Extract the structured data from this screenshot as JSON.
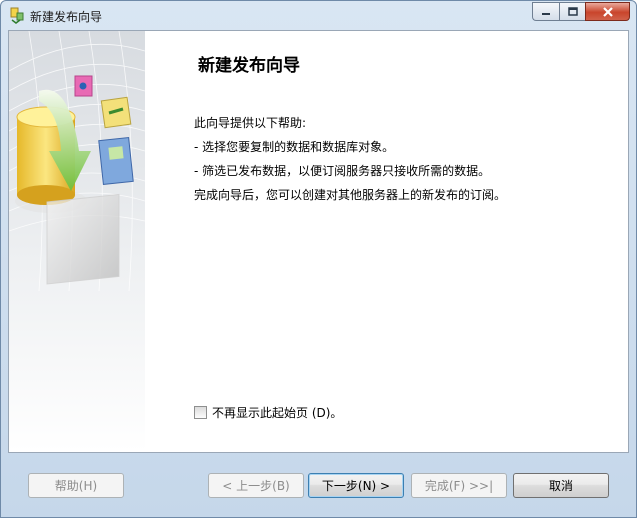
{
  "window": {
    "title": "新建发布向导"
  },
  "page": {
    "heading": "新建发布向导",
    "intro": "此向导提供以下帮助:",
    "bullets": [
      "-  选择您要复制的数据和数据库对象。",
      "-  筛选已发布数据，以便订阅服务器只接收所需的数据。"
    ],
    "completion": "完成向导后，您可以创建对其他服务器上的新发布的订阅。",
    "dont_show_label": "不再显示此起始页 (D)。",
    "dont_show_checked": false
  },
  "buttons": {
    "help": "帮助(H)",
    "back": "< 上一步(B)",
    "next": "下一步(N) >",
    "finish": "完成(F) >>|",
    "cancel": "取消"
  },
  "colors": {
    "title_bar": "#d4e3f2",
    "close_button": "#c9452c",
    "default_button_border": "#3c7fb1"
  }
}
